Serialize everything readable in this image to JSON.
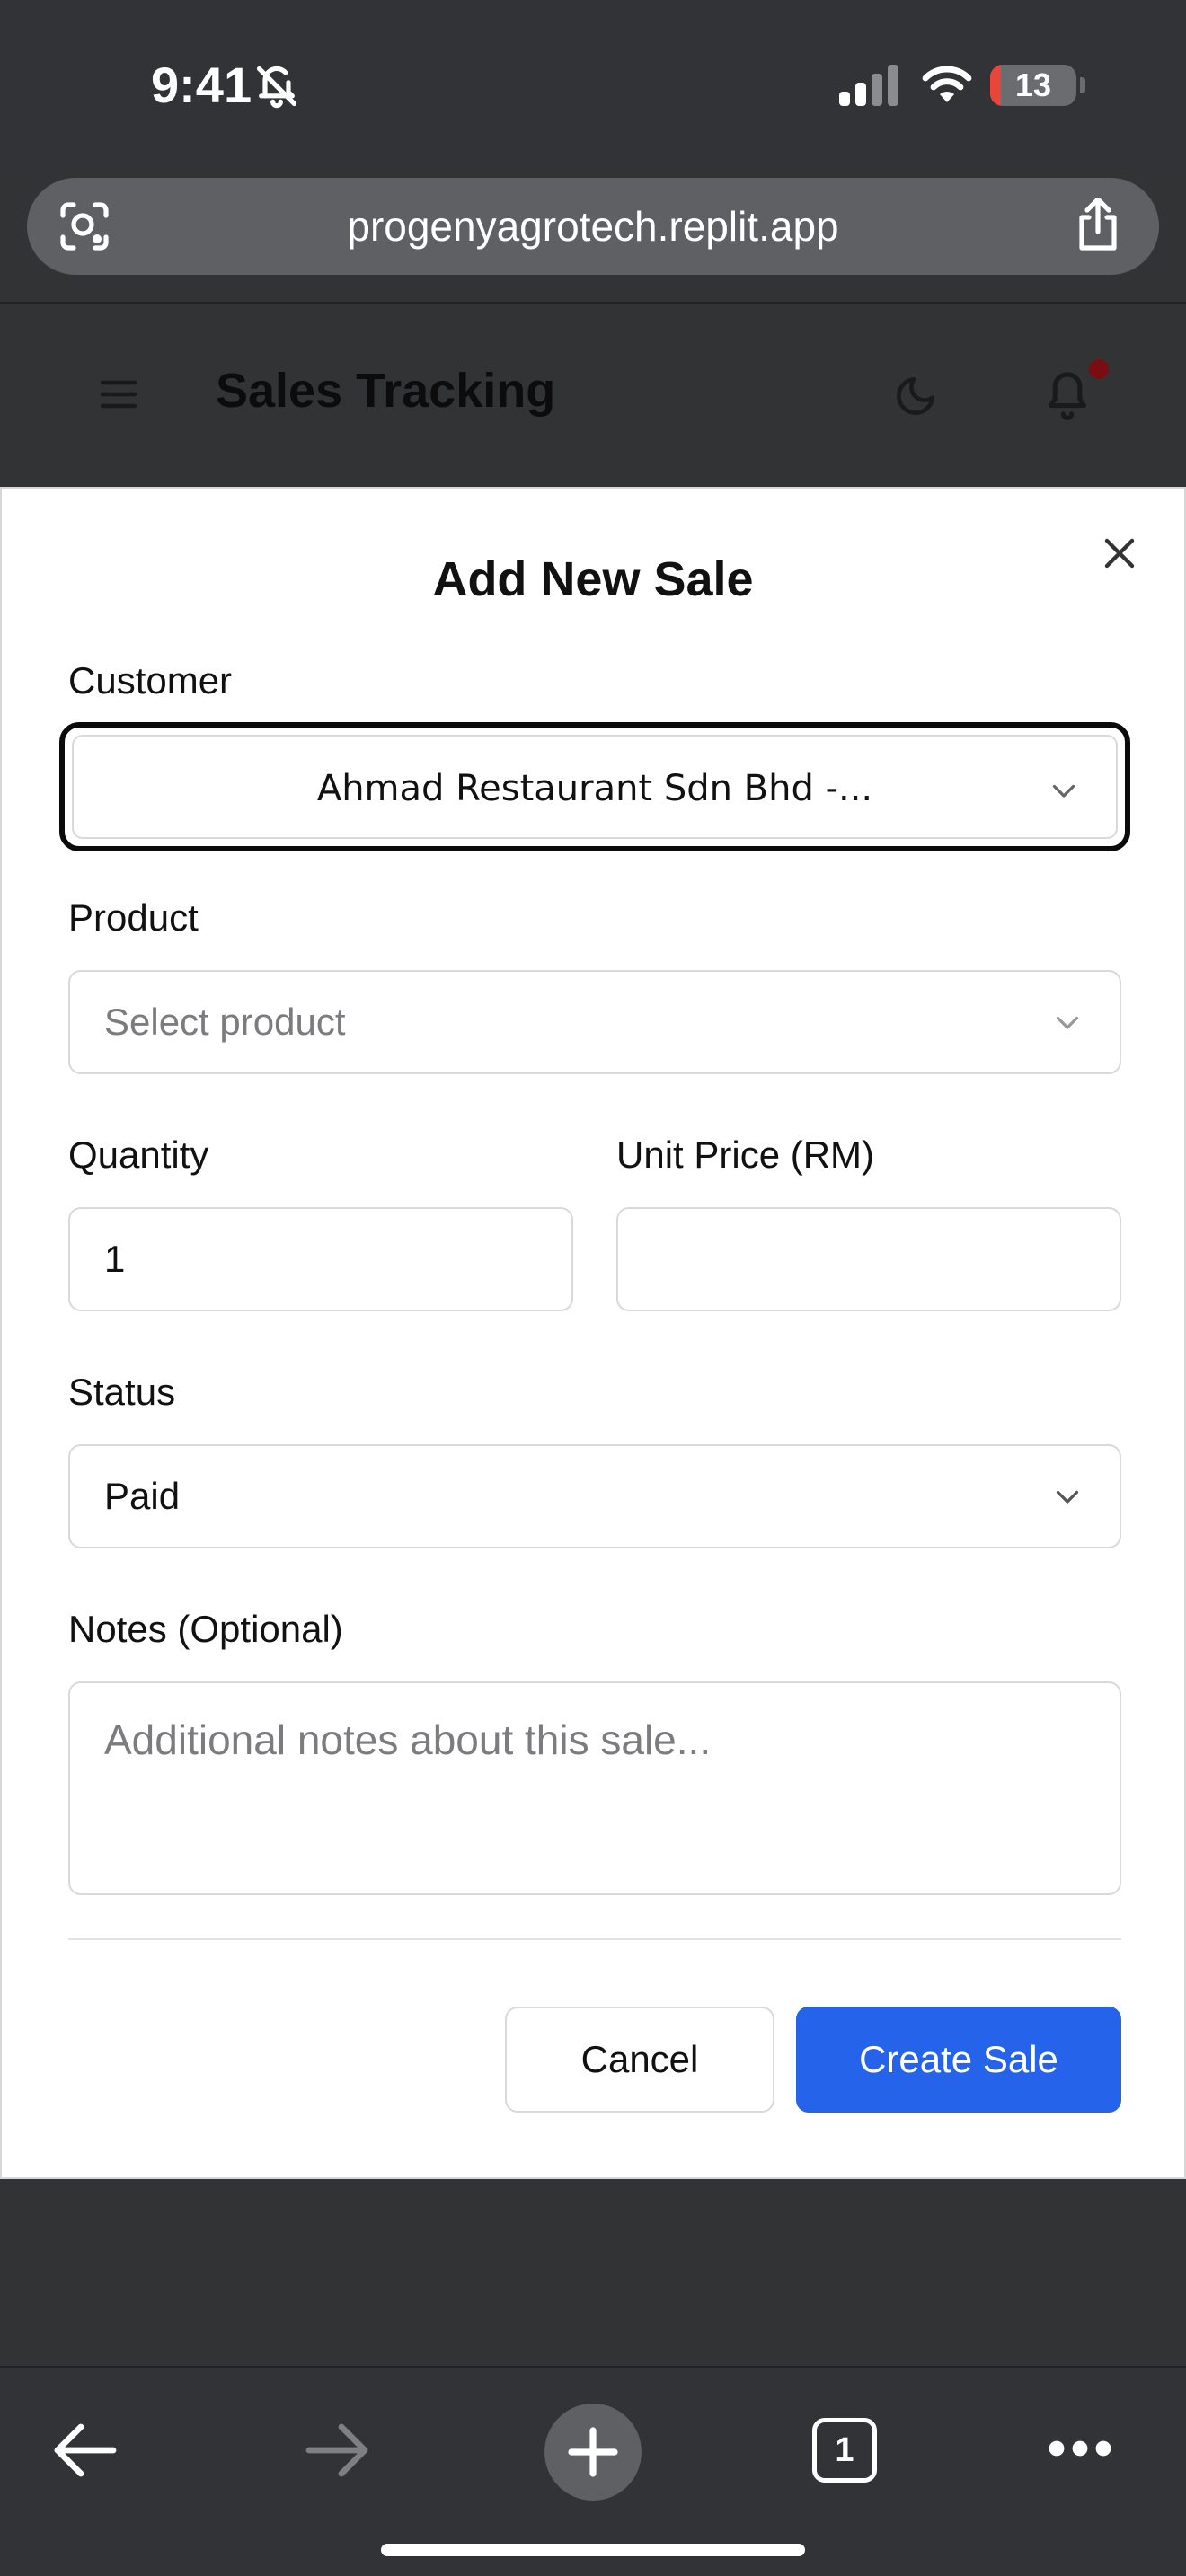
{
  "status_bar": {
    "time": "9:41",
    "battery_level": "13",
    "battery_fraction": 0.13,
    "battery_color": "#e8453c"
  },
  "browser": {
    "url": "progenyagrotech.replit.app",
    "tab_count": "1"
  },
  "header": {
    "title": "Sales Tracking"
  },
  "modal": {
    "title": "Add New Sale",
    "customer": {
      "label": "Customer",
      "value": "Ahmad Restaurant Sdn Bhd -..."
    },
    "product": {
      "label": "Product",
      "placeholder": "Select product"
    },
    "quantity": {
      "label": "Quantity",
      "value": "1"
    },
    "unit_price": {
      "label": "Unit Price (RM)",
      "value": ""
    },
    "status": {
      "label": "Status",
      "value": "Paid"
    },
    "notes": {
      "label": "Notes (Optional)",
      "placeholder": "Additional notes about this sale..."
    },
    "cancel_label": "Cancel",
    "create_label": "Create Sale"
  },
  "colors": {
    "primary": "#2563eb",
    "notification_dot": "#7a0d10"
  }
}
